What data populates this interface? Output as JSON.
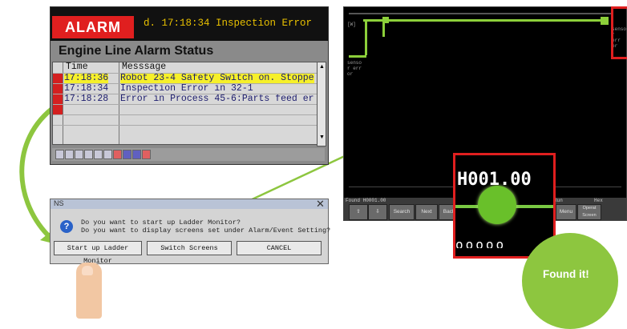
{
  "alarm_panel": {
    "badge": "ALARM",
    "topbar_text": "d.    17:18:34 Inspection Error",
    "title": "Engine Line Alarm Status",
    "col_time": "Time",
    "col_message": "Messsage",
    "rows": [
      {
        "time": "17:18:36",
        "message": "Robot 23-4 Safety Switch on. Stoppe"
      },
      {
        "time": "17:18:34",
        "message": "Inspection Error in 32-1"
      },
      {
        "time": "17:18:28",
        "message": "Error in Process 45-6:Parts feed er"
      }
    ]
  },
  "dialog": {
    "title": "NS",
    "line1": "Do you want to start up Ladder Monitor?",
    "line2": "Do you want to display screens set under Alarm/Event Setting?",
    "btn_start": "Start up Ladder Monitor",
    "btn_switch": "Switch Screens",
    "btn_cancel": "CANCEL"
  },
  "ladder": {
    "left_label_top": "[W]",
    "left_label_mid": "senso r err or",
    "right_label": "senso r err or",
    "status_left": "Found H0001.00",
    "status_run": "Run",
    "status_hex": "Hex",
    "buttons": {
      "search": "Search",
      "next": "Next",
      "back": "Back",
      "menu": "Menu",
      "operation": "Operat Screen"
    }
  },
  "zoom": {
    "value": "H001.00",
    "cut_text": "ooooo"
  },
  "callout": {
    "text": "Found it!"
  },
  "colors": {
    "alarm_red": "#e01f1f",
    "green": "#8dc63f",
    "highlight": "#f6f02a"
  }
}
